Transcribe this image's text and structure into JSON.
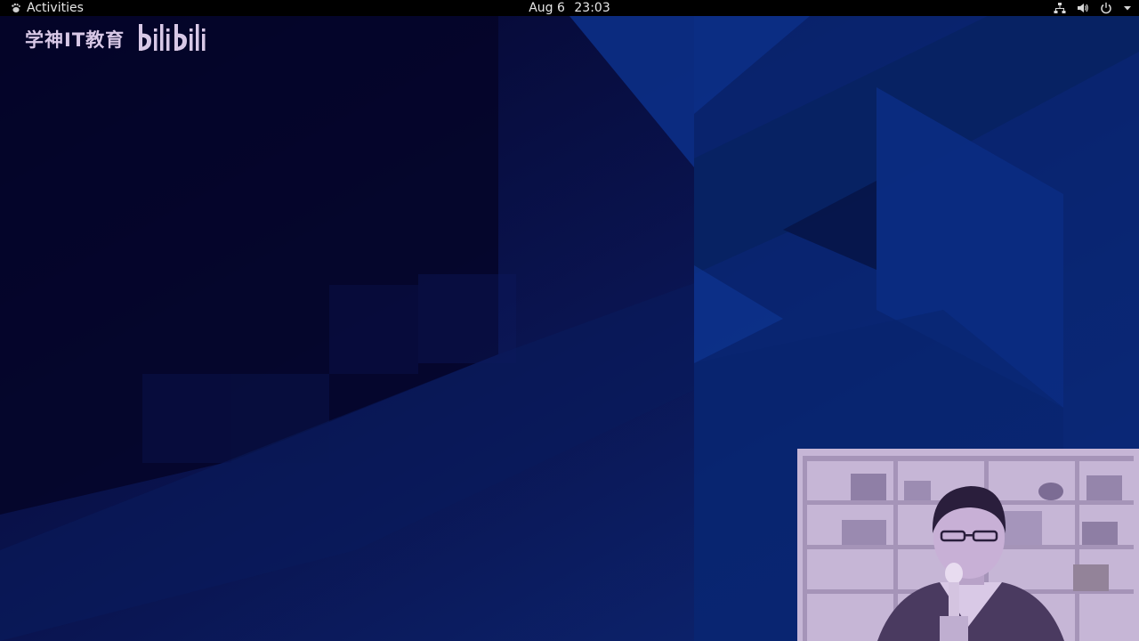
{
  "topbar": {
    "activities_label": "Activities",
    "date": "Aug 6",
    "time": "23:03",
    "icons": [
      "gnome-foot-icon",
      "network-icon",
      "volume-icon",
      "power-icon",
      "chevron-down-icon"
    ]
  },
  "watermark": {
    "text": "学神IT教育",
    "logo": "bilibili"
  },
  "colors": {
    "topbar_bg": "#000000",
    "topbar_text": "#e6e6e6",
    "wallpaper_dark": "#06062a",
    "wallpaper_blue": "#0c2a78",
    "webcam_tint": "#c3b2d2"
  }
}
